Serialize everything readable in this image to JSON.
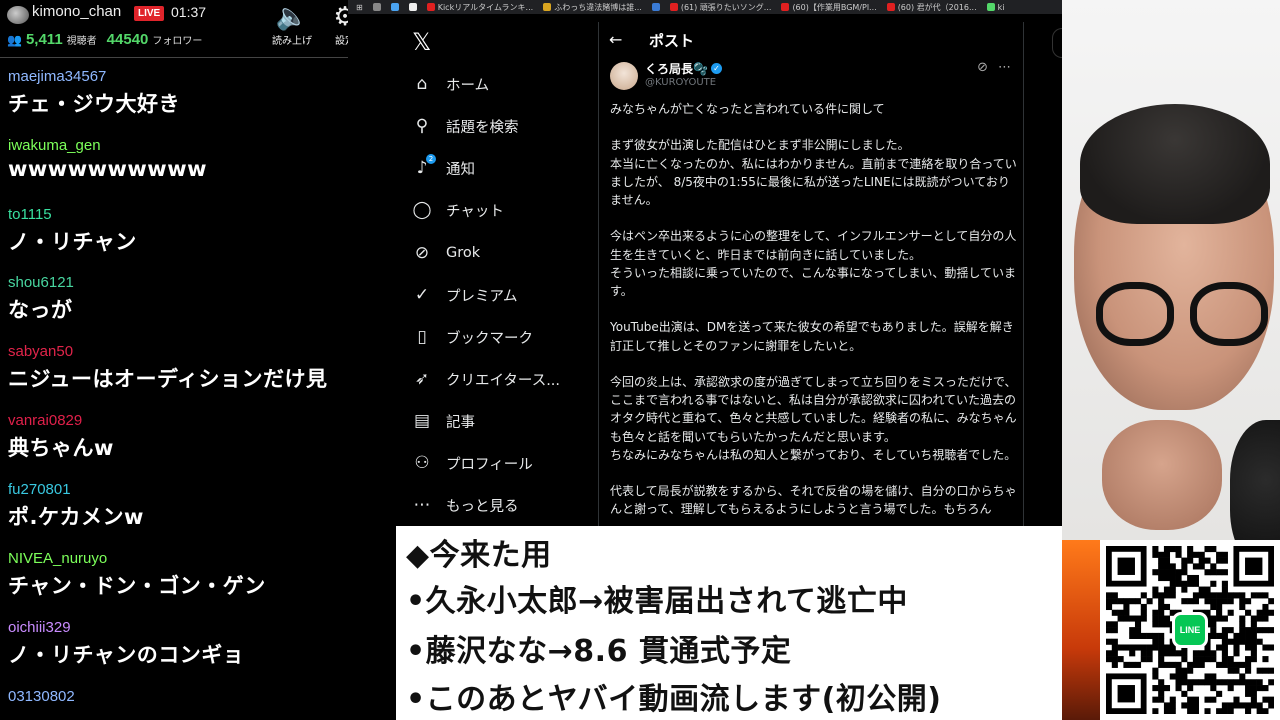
{
  "chat": {
    "header": {
      "streamer": "kimono_chan",
      "live": "LIVE",
      "time": "01:37",
      "viewers": "5,411",
      "viewers_label": "視聴者",
      "followers": "44540",
      "followers_label": "フォロワー",
      "tools": [
        {
          "label": "読み上げ",
          "icon": "speaker-icon"
        },
        {
          "label": "設定",
          "icon": "gear-icon"
        }
      ]
    },
    "messages": [
      {
        "user": "maejima34567",
        "color": "#8fb8ff",
        "text": "チェ・ジウ大好き"
      },
      {
        "user": "iwakuma_gen",
        "color": "#7cff5a",
        "text": "wwwwwwwwww"
      },
      {
        "user": "to1115",
        "color": "#39e0a0",
        "text": "ノ・リチャン"
      },
      {
        "user": "shou6121",
        "color": "#48d6a0",
        "text": "なっが"
      },
      {
        "user": "sabyan50",
        "color": "#e0244a",
        "text": "ニジューはオーディションだけ見"
      },
      {
        "user": "vanrai0829",
        "color": "#e0204a",
        "text": "典ちゃんw"
      },
      {
        "user": "fu270801",
        "color": "#39c8e0",
        "text": "ポ.ケカメンw"
      },
      {
        "user": "NIVEA_nuruyo",
        "color": "#7cff5a",
        "text": "チャン・ドン・ゴン・ゲン"
      },
      {
        "user": "oichiii329",
        "color": "#c98cff",
        "text": "ノ・リチャンのコンギョ"
      },
      {
        "user": "03130802",
        "color": "#8fb8ff",
        "text": ""
      }
    ]
  },
  "bookmarks": [
    {
      "label": "",
      "color": "#888"
    },
    {
      "label": "",
      "color": "#4aa3f0"
    },
    {
      "label": "",
      "color": "#eee"
    },
    {
      "label": "Kickリアルタイムランキ...",
      "color": "#e02020"
    },
    {
      "label": "ふわっち違法賭博は誰...",
      "color": "#d9a520"
    },
    {
      "label": "",
      "color": "#3a7bd5"
    },
    {
      "label": "(61) 頑張りたいソング...",
      "color": "#e02020"
    },
    {
      "label": "(60)【作業用BGM/Pl...",
      "color": "#e02020"
    },
    {
      "label": "(60) 君が代（2016...",
      "color": "#e02020"
    },
    {
      "label": "ki",
      "color": "#53d769"
    }
  ],
  "xnav": {
    "logo": "𝕏",
    "items": [
      {
        "label": "ホーム",
        "icon": "home-icon",
        "glyph": "⌂"
      },
      {
        "label": "話題を検索",
        "icon": "search-icon",
        "glyph": "⚲"
      },
      {
        "label": "通知",
        "icon": "bell-icon",
        "glyph": "🔔",
        "badge": "2"
      },
      {
        "label": "チャット",
        "icon": "chat-icon",
        "glyph": "◯"
      },
      {
        "label": "Grok",
        "icon": "grok-icon",
        "glyph": "⊘"
      },
      {
        "label": "プレミアム",
        "icon": "premium-icon",
        "glyph": "✓"
      },
      {
        "label": "ブックマーク",
        "icon": "bookmark-icon",
        "glyph": "▯"
      },
      {
        "label": "クリエイタース...",
        "icon": "creator-icon",
        "glyph": "➶"
      },
      {
        "label": "記事",
        "icon": "article-icon",
        "glyph": "▤"
      },
      {
        "label": "プロフィール",
        "icon": "profile-icon",
        "glyph": "⚇"
      },
      {
        "label": "もっと見る",
        "icon": "more-icon",
        "glyph": "⋯"
      }
    ]
  },
  "post": {
    "header": "ポスト",
    "author": "くろ局長🫧",
    "handle": "@KUROYOUTE",
    "paragraphs": [
      "みなちゃんが亡くなったと言われている件に関して",
      "まず彼女が出演した配信はひとまず非公開にしました。\n本当に亡くなったのか、私にはわかりません。直前まで連絡を取り合っていましたが、 8/5夜中の1:55に最後に私が送ったLINEには既読がついておりません。",
      "今はペン卒出来るように心の整理をして、インフルエンサーとして自分の人生を生きていくと、昨日までは前向きに話していました。\nそういった相談に乗っていたので、こんな事になってしまい、動揺しています。",
      "YouTube出演は、DMを送って来た彼女の希望でもありました。誤解を解き訂正して推しとそのファンに謝罪をしたいと。",
      "今回の炎上は、承認欲求の度が過ぎてしまって立ち回りをミスっただけで、ここまで言われる事ではないと、私は自分が承認欲求に囚われていた過去のオタク時代と重ねて、色々と共感していました。経験者の私に、みなちゃんも色々と話を聞いてもらいたかったんだと思います。\nちなみにみなちゃんは私の知人と繋がっており、そしていち視聴者でした。",
      "代表して局長が説教をするから、それで反省の場を儲け、自分の口からちゃんと謝って、理解してもらえるようにしようと言う場でした。もちろん"
    ]
  },
  "overlay": {
    "lines": [
      "◆今来た用",
      "•久永小太郎→被害届出されて逃亡中",
      "•藤沢なな→8.6 貫通式予定",
      "•このあとヤバイ動画流します(初公開)"
    ]
  },
  "qr": {
    "badge": "LINE"
  }
}
